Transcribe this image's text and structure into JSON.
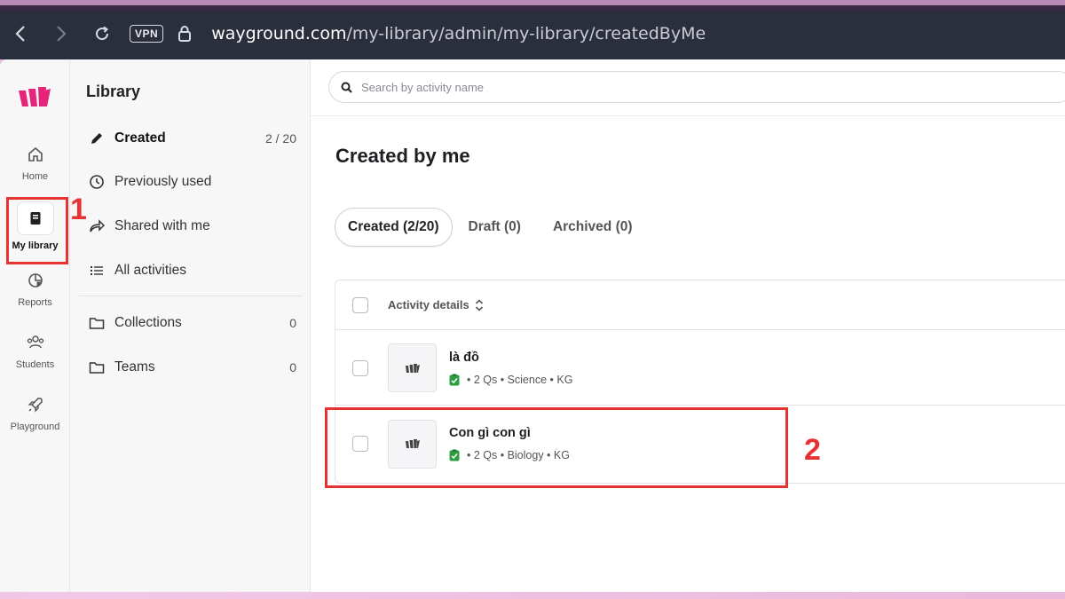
{
  "browser": {
    "url_host": "wayground.com",
    "url_path": "/my-library/admin/my-library/createdByMe",
    "vpn_label": "VPN"
  },
  "rail": {
    "items": [
      {
        "label": "Home",
        "icon": "home-icon"
      },
      {
        "label": "My library",
        "icon": "book-icon"
      },
      {
        "label": "Reports",
        "icon": "pie-chart-icon"
      },
      {
        "label": "Students",
        "icon": "users-icon"
      },
      {
        "label": "Playground",
        "icon": "rocket-icon"
      }
    ]
  },
  "library": {
    "title": "Library",
    "items": [
      {
        "label": "Created",
        "count": "2 / 20",
        "icon": "pencil-icon"
      },
      {
        "label": "Previously used",
        "icon": "clock-icon"
      },
      {
        "label": "Shared with me",
        "icon": "share-icon"
      },
      {
        "label": "All activities",
        "icon": "list-icon"
      },
      {
        "label": "Collections",
        "count": "0",
        "icon": "folder-icon"
      },
      {
        "label": "Teams",
        "count": "0",
        "icon": "folder-icon"
      }
    ]
  },
  "main": {
    "search_placeholder": "Search by activity name",
    "title": "Created by me",
    "tabs": [
      {
        "label": "Created (2/20)"
      },
      {
        "label": "Draft (0)"
      },
      {
        "label": "Archived (0)"
      }
    ],
    "table": {
      "header": "Activity details",
      "rows": [
        {
          "title": "là đồ",
          "meta": "• 2 Qs • Science • KG"
        },
        {
          "title": "Con gì con gì",
          "meta": "• 2 Qs • Biology • KG"
        }
      ]
    }
  },
  "annotations": {
    "one": "1",
    "two": "2",
    "color": "#e53232"
  },
  "colors": {
    "brand": "#e5247a",
    "highlight": "#e53232"
  }
}
